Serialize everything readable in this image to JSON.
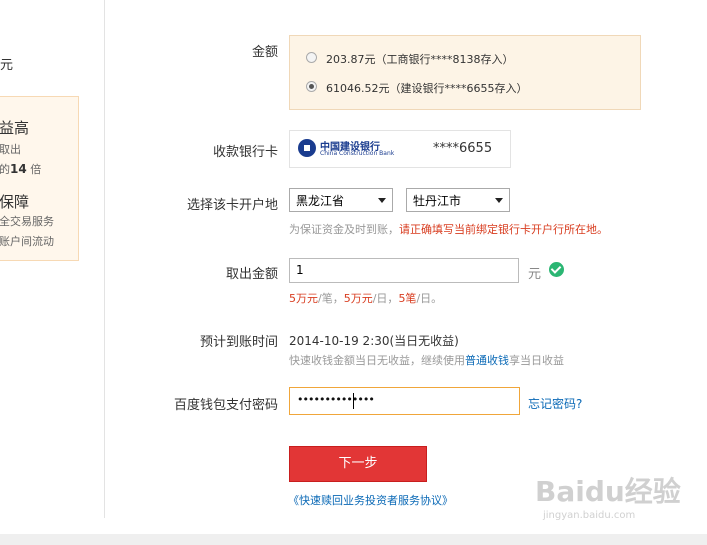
{
  "sidebar": {
    "yuan": "元",
    "promo": {
      "title1": "益高",
      "line1": "取出",
      "line2_pre": "的",
      "line2_bold": "14",
      "line2_post": " 倍",
      "title2": "保障",
      "line3": "全交易服务",
      "line4": "账户间流动"
    }
  },
  "form": {
    "amount_label": "金额",
    "options": [
      {
        "text": "203.87元（工商银行****8138存入）",
        "checked": false
      },
      {
        "text": "61046.52元（建设银行****6655存入）",
        "checked": true
      }
    ],
    "card_label": "收款银行卡",
    "bank_name_cn": "中国建设银行",
    "bank_name_en": "China Construction Bank",
    "card_number": "****6655",
    "location_label": "选择该卡开户地",
    "province": "黑龙江省",
    "city": "牡丹江市",
    "location_hint_gray": "为保证资金及时到账，",
    "location_hint_red": "请正确填写当前绑定银行卡开户行所在地。",
    "withdraw_label": "取出金额",
    "withdraw_value": "1",
    "unit": "元",
    "limit_a": "5万元",
    "limit_a_suffix": "/笔，",
    "limit_b": "5万元",
    "limit_b_suffix": "/日，",
    "limit_c": "5笔",
    "limit_c_suffix": "/日。",
    "arrival_label": "预计到账时间",
    "arrival_time": "2014-10-19 2:30(当日无收益)",
    "arrival_hint_pre": "快速收钱金额当日无收益，继续使用",
    "arrival_hint_link": "普通收钱",
    "arrival_hint_post": "享当日收益",
    "password_label": "百度钱包支付密码",
    "password_mask": "••••••••••••••",
    "forgot_link": "忘记密码?",
    "next_button": "下一步",
    "agreement_link": "《快速赎回业务投资者服务协议》"
  },
  "watermark": {
    "main": "Baidu经验",
    "sub": "jingyan.baidu.com"
  },
  "colors": {
    "accent_red": "#e23636",
    "link_blue": "#0a69b6",
    "warning_red": "#d83c1f",
    "success_green": "#2bb673",
    "highlight_bg": "#fdf4e6"
  }
}
